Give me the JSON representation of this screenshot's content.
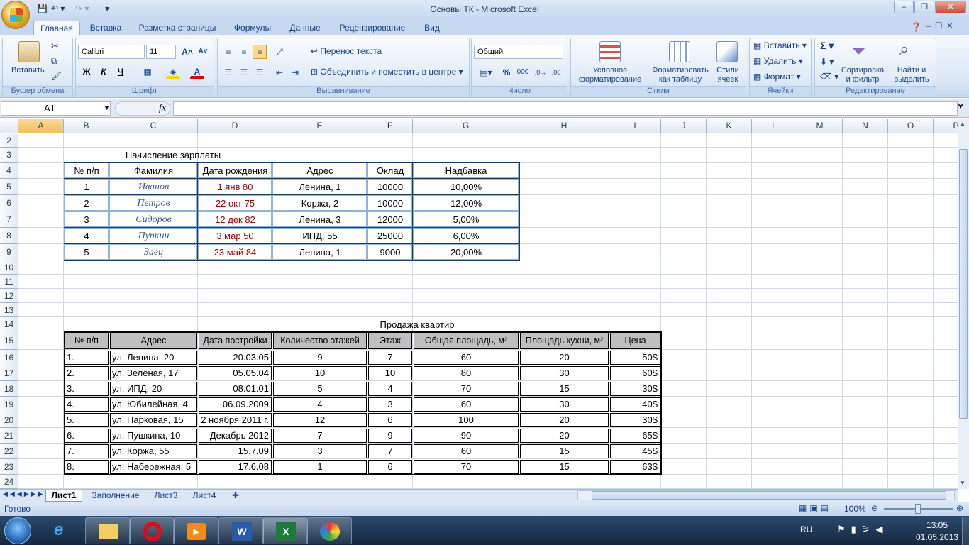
{
  "window": {
    "title": "Основы ТК - Microsoft Excel"
  },
  "tabs": [
    "Главная",
    "Вставка",
    "Разметка страницы",
    "Формулы",
    "Данные",
    "Рецензирование",
    "Вид"
  ],
  "ribbon": {
    "clipboard": {
      "paste": "Вставить",
      "label": "Буфер обмена"
    },
    "font": {
      "name": "Calibri",
      "size": "11",
      "bold": "Ж",
      "italic": "К",
      "underline": "Ч",
      "label": "Шрифт"
    },
    "alignment": {
      "wrap": "Перенос текста",
      "merge": "Объединить и поместить в центре",
      "label": "Выравнивание"
    },
    "number": {
      "format": "Общий",
      "percent": "%",
      "thousands": "000",
      "label": "Число"
    },
    "styles": {
      "conditional": "Условное форматирование",
      "table": "Форматировать как таблицу",
      "cell_styles": "Стили ячеек",
      "label": "Стили"
    },
    "cells": {
      "insert": "Вставить",
      "delete": "Удалить",
      "format": "Формат",
      "label": "Ячейки"
    },
    "editing": {
      "sort": "Сортировка и фильтр",
      "find": "Найти и выделить",
      "label": "Редактирование"
    }
  },
  "formula_bar": {
    "name_box": "A1",
    "fx": "fx",
    "value": ""
  },
  "columns": [
    "A",
    "B",
    "C",
    "D",
    "E",
    "F",
    "G",
    "H",
    "I",
    "J",
    "K",
    "L",
    "M",
    "N",
    "O",
    "P"
  ],
  "rows": [
    "2",
    "3",
    "4",
    "5",
    "6",
    "7",
    "8",
    "9",
    "10",
    "11",
    "12",
    "13",
    "14",
    "15",
    "16",
    "17",
    "18",
    "19",
    "20",
    "21",
    "22",
    "23",
    "24"
  ],
  "salary": {
    "title": "Начисление зарплаты",
    "headers": [
      "№ п/п",
      "Фамилия",
      "Дата рождения",
      "Адрес",
      "Оклад",
      "Надбавка"
    ],
    "rows": [
      [
        "1",
        "Иванов",
        "1 янв 80",
        "Ленина, 1",
        "10000",
        "10,00%"
      ],
      [
        "2",
        "Петров",
        "22 окт 75",
        "Коржа, 2",
        "10000",
        "12,00%"
      ],
      [
        "3",
        "Сидоров",
        "12 дек 82",
        "Ленина, 3",
        "12000",
        "5,00%"
      ],
      [
        "4",
        "Пупкин",
        "3 мар 50",
        "ИПД, 55",
        "25000",
        "6,00%"
      ],
      [
        "5",
        "Заец",
        "23 май 84",
        "Ленина, 1",
        "9000",
        "20,00%"
      ]
    ]
  },
  "apartments": {
    "title": "Продажа квартир",
    "headers": [
      "№ п/п",
      "Адрес",
      "Дата постройки",
      "Количество этажей",
      "Этаж",
      "Общая площадь, м²",
      "Площадь кухни, м²",
      "Цена"
    ],
    "rows": [
      [
        "1.",
        "ул. Ленина, 20",
        "20.03.05",
        "9",
        "7",
        "60",
        "20",
        "50$"
      ],
      [
        "2.",
        "ул. Зелёная, 17",
        "05.05.04",
        "10",
        "10",
        "80",
        "30",
        "60$"
      ],
      [
        "3.",
        "ул. ИПД, 20",
        "08.01.01",
        "5",
        "4",
        "70",
        "15",
        "30$"
      ],
      [
        "4.",
        "ул. Юбилейная, 4",
        "06.09.2009",
        "4",
        "3",
        "60",
        "30",
        "40$"
      ],
      [
        "5.",
        "ул. Парковая, 15",
        "2 ноября 2011 г.",
        "12",
        "6",
        "100",
        "20",
        "30$"
      ],
      [
        "6.",
        "ул. Пушкина, 10",
        "Декабрь 2012",
        "7",
        "9",
        "90",
        "20",
        "65$"
      ],
      [
        "7.",
        "ул. Коржа, 55",
        "15.7.09",
        "3",
        "7",
        "60",
        "15",
        "45$"
      ],
      [
        "8.",
        "ул. Набережная, 5",
        "17.6.08",
        "1",
        "6",
        "70",
        "15",
        "63$"
      ]
    ]
  },
  "sheets": [
    "Лист1",
    "Заполнение",
    "Лист3",
    "Лист4"
  ],
  "status": {
    "ready": "Готово",
    "zoom": "100%"
  },
  "taskbar": {
    "lang": "RU",
    "time": "13:05",
    "date": "01.05.2013"
  }
}
